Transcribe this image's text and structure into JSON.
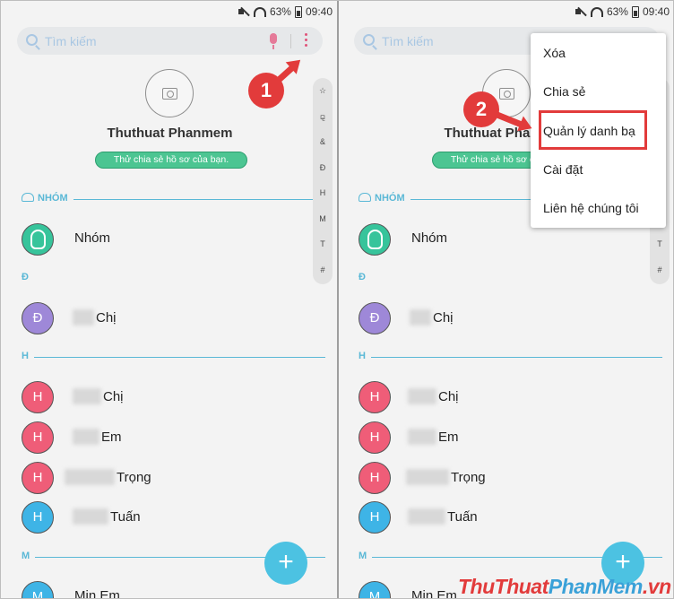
{
  "status": {
    "battery": "63%",
    "time": "09:40"
  },
  "search": {
    "placeholder": "Tìm kiếm"
  },
  "profile": {
    "name": "Thuthuat Phanmem",
    "share_button": "Thử chia sẻ hồ sơ của bạn."
  },
  "index_letters": [
    "☆",
    "⚼",
    "&",
    "Đ",
    "H",
    "M",
    "T",
    "#"
  ],
  "sections": {
    "groups": "NHÓM",
    "d": "Đ",
    "h": "H",
    "m": "M"
  },
  "contacts": {
    "group": {
      "initial": "",
      "name": "Nhóm"
    },
    "chi_d": {
      "initial": "Đ",
      "name": "Chị"
    },
    "chi_h": {
      "initial": "H",
      "name": "Chị"
    },
    "em": {
      "initial": "H",
      "name": "Em"
    },
    "trong": {
      "initial": "H",
      "name": "Trọng"
    },
    "tuan": {
      "initial": "H",
      "name": "Tuấn"
    },
    "min_em": {
      "initial": "M",
      "name": "Min Em"
    }
  },
  "fab": {
    "label": "+"
  },
  "menu": {
    "items": [
      "Xóa",
      "Chia sẻ",
      "Quản lý danh bạ",
      "Cài đặt",
      "Liên hệ chúng tôi"
    ]
  },
  "annotations": {
    "step1": "1",
    "step2": "2"
  },
  "watermark": {
    "part1": "ThuThuat",
    "part2": "PhanMem",
    "part3": ".vn"
  },
  "colors": {
    "accent": "#5ab8d6",
    "highlight": "#e23b3b",
    "fab": "#4cc2e2",
    "share": "#4cc592"
  }
}
